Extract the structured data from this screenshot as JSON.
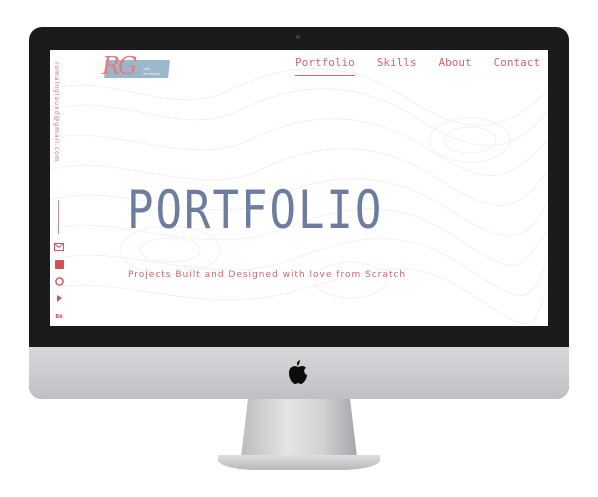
{
  "logo": {
    "initials": "RG",
    "tagline": "web developer"
  },
  "nav": {
    "items": [
      "Portfolio",
      "Skills",
      "About",
      "Contact"
    ],
    "active": "Portfolio"
  },
  "sidebar": {
    "email": "romalnglouxd@gmail.com",
    "social": [
      {
        "name": "mail-icon"
      },
      {
        "name": "linkedin-icon",
        "glyph": "in"
      },
      {
        "name": "github-icon"
      },
      {
        "name": "codewars-icon"
      },
      {
        "name": "behance-icon",
        "glyph": "Bē"
      },
      {
        "name": "upwork-icon",
        "glyph": "Up"
      }
    ]
  },
  "hero": {
    "title": "PORTFOLIO",
    "subtitle": "Projects Built and Designed with love from Scratch"
  },
  "colors": {
    "accent": "#d9636b",
    "title": "#6c7da0",
    "bezel": "#1b1b1d",
    "logo_bg": "#8fb0c6"
  }
}
